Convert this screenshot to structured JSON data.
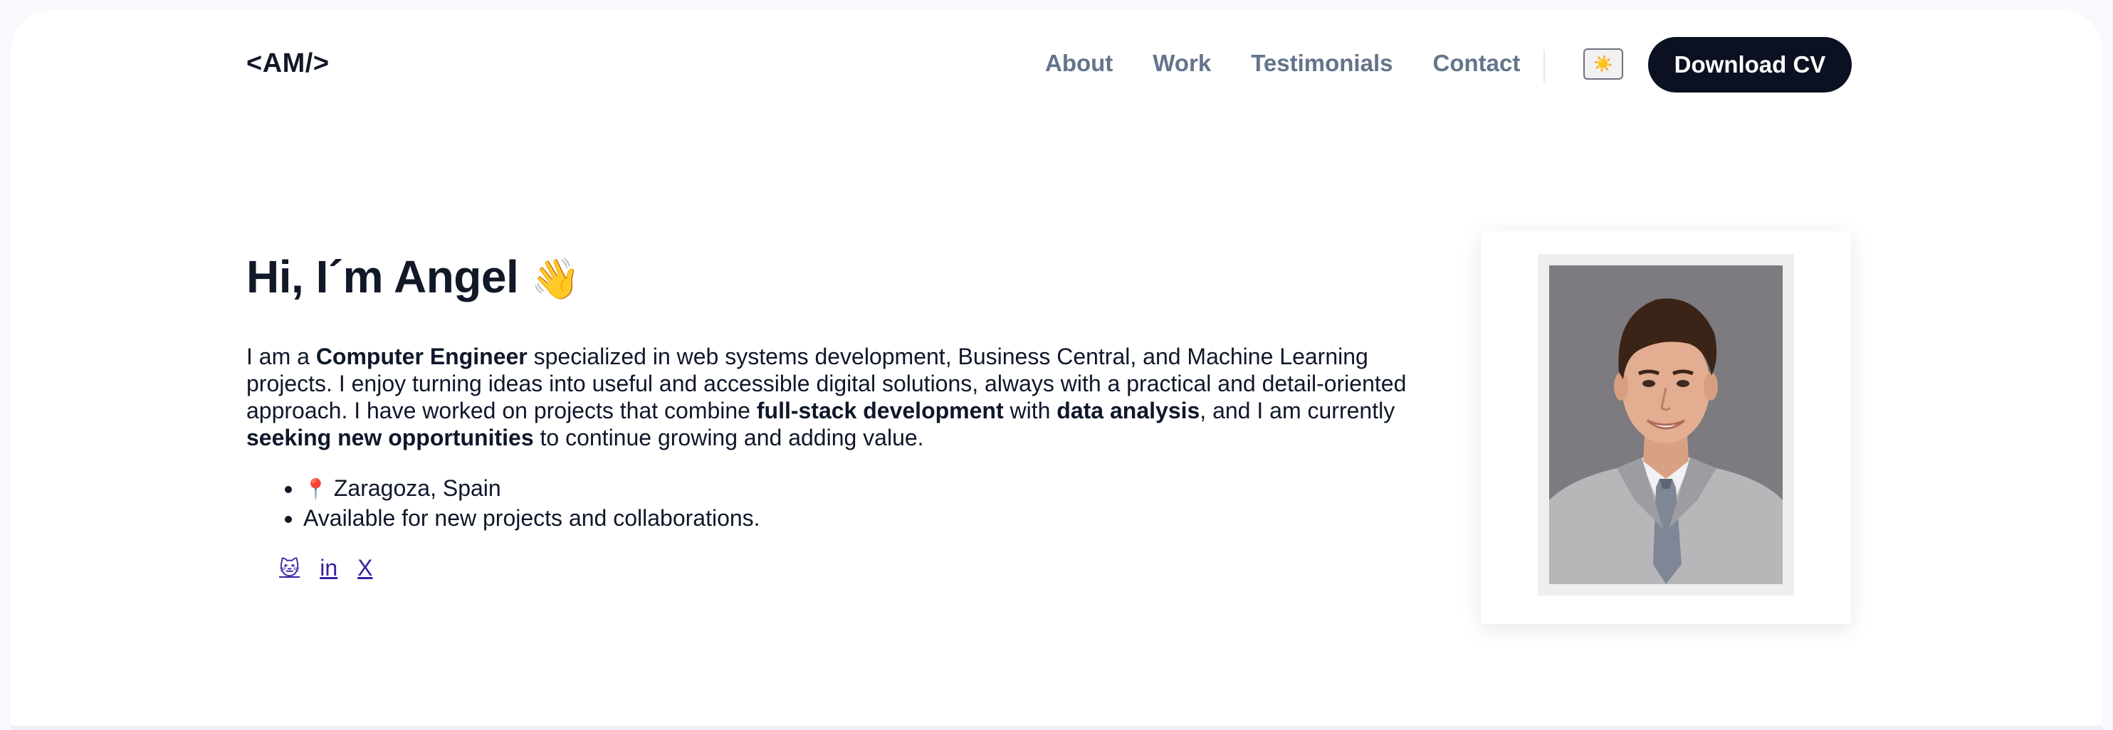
{
  "header": {
    "logo": "<AM/>",
    "nav": [
      {
        "label": "About"
      },
      {
        "label": "Work"
      },
      {
        "label": "Testimonials"
      },
      {
        "label": "Contact"
      }
    ],
    "theme_toggle_icon": "sun-icon",
    "theme_toggle_glyph": "☀️",
    "cv_button": "Download CV"
  },
  "hero": {
    "title": "Hi, I´m Angel",
    "wave_emoji": "👋",
    "intro": {
      "t1": "I am a ",
      "b1": "Computer Engineer",
      "t2": " specialized in web systems development, Business Central, and Machine Learning projects. I enjoy turning ideas into useful and accessible digital solutions, always with a practical and detail-oriented approach. I have worked on projects that combine ",
      "b2": "full-stack development",
      "t3": " with ",
      "b3": "data analysis",
      "t4": ", and I am currently ",
      "b4": "seeking new opportunities",
      "t5": " to continue growing and adding value."
    },
    "location_icon": "📍",
    "location": "Zaragoza, Spain",
    "availability": "Available for new projects and collaborations.",
    "socials": [
      {
        "label": "🐱",
        "icon": "github-cat-icon"
      },
      {
        "label": "in",
        "icon": "linkedin-icon"
      },
      {
        "label": "X",
        "icon": "x-icon"
      }
    ]
  },
  "colors": {
    "background": "#f8f9fd",
    "card": "#ffffff",
    "text": "#0f172a",
    "nav_text": "#64748b",
    "button_bg": "#0b1120",
    "link": "#3b1fa3"
  }
}
